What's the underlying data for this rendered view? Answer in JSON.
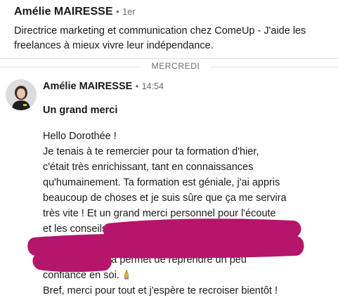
{
  "header": {
    "name": "Amélie MAIRESSE",
    "separator": "•",
    "degree": "1er",
    "headline": "Directrice marketing et communication chez ComeUp - J'aide les freelances à mieux vivre leur indépendance."
  },
  "day_divider": {
    "label": "MERCREDI"
  },
  "message": {
    "sender": "Amélie MAIRESSE",
    "separator": "•",
    "time": "14:54",
    "subject": "Un grand merci",
    "lines": [
      "Hello Dorothée !",
      "Je tenais à te remercier pour ta formation d'hier,",
      "c'était très enrichissant, tant en connaissances",
      "qu'humainement. Ta formation est géniale, j'ai appris",
      "beaucoup de choses et je suis sûre que ça me servira",
      "très vite ! Et un grand merci personnel pour l'écoute",
      "et les conseils",
      "",
      "ça permet de reprendre un peu",
      "confiance en soi.",
      "Bref, merci pour tout et j'espère te recroiser bientôt !"
    ]
  },
  "colors": {
    "redaction": "#b5156a",
    "text": "#191919",
    "muted": "#666666"
  }
}
